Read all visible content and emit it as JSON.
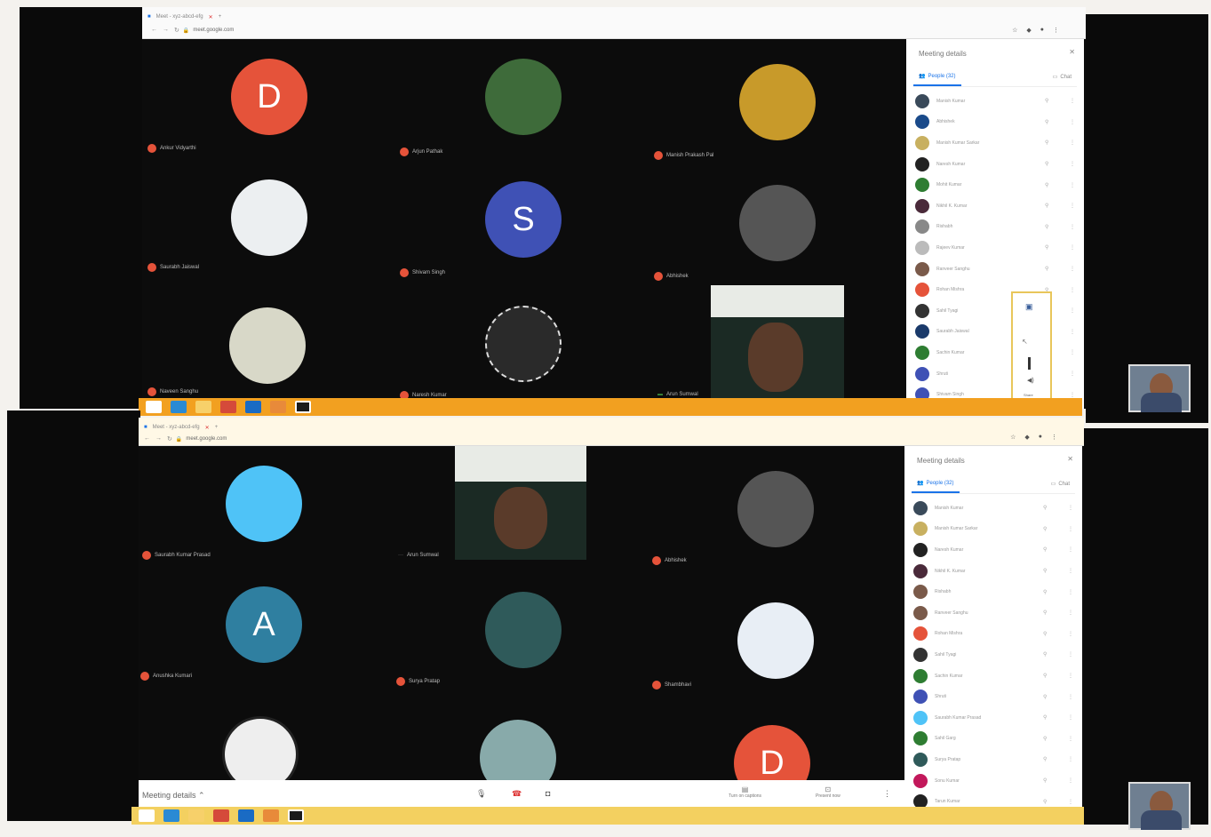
{
  "colors": {
    "accent": "#1a73e8",
    "mic_muted": "#e5533a",
    "taskbar_orange": "#f2a020"
  },
  "top": {
    "browser": {
      "tab_title": "Meet - xyz-abcd-efg",
      "url": "meet.google.com"
    },
    "tiles": [
      {
        "name": "Ankur Vidyarthi",
        "initial": "D",
        "color": "#e5533a",
        "type": "letter"
      },
      {
        "name": "Arjun Pathak",
        "color": "#3e6b3a",
        "type": "photo"
      },
      {
        "name": "Manish Prakash Pal",
        "color": "#c89a2a",
        "type": "photo"
      },
      {
        "name": "Saurabh Jaiswal",
        "color": "#eceff1",
        "type": "photo"
      },
      {
        "name": "Shivam Singh",
        "initial": "S",
        "color": "#3f51b5",
        "type": "letter"
      },
      {
        "name": "Abhishek",
        "color": "#555",
        "type": "photo"
      },
      {
        "name": "Naveen Sanghu",
        "color": "#d8d8c8",
        "type": "photo"
      },
      {
        "name": "Naresh Kumar",
        "color": "#2a2a2a",
        "type": "photo"
      },
      {
        "name": "Arun Sumwal",
        "type": "video"
      }
    ],
    "panel": {
      "title": "Meeting details",
      "tab_people": "People (32)",
      "tab_chat": "Chat",
      "participants": [
        {
          "name": "Manish Kumar",
          "color": "#3a4a5a"
        },
        {
          "name": "Abhishek",
          "color": "#1a4a8a"
        },
        {
          "name": "Manish Kumar Sarkar",
          "color": "#c8b060"
        },
        {
          "name": "Naresh Kumar",
          "color": "#222"
        },
        {
          "name": "Mohit Kumar",
          "color": "#2e7d32"
        },
        {
          "name": "Nikhil K. Kumar",
          "color": "#4a2a3a"
        },
        {
          "name": "Rishabh",
          "color": "#888"
        },
        {
          "name": "Rajeev Kumar",
          "color": "#bbb"
        },
        {
          "name": "Ranveer Sanghu",
          "color": "#7a5a4a"
        },
        {
          "name": "Rohan Mishra",
          "color": "#e5533a"
        },
        {
          "name": "Sahil Tyagi",
          "color": "#333"
        },
        {
          "name": "Saurabh Jaiswal",
          "color": "#1a3a6a"
        },
        {
          "name": "Sachin Kumar",
          "color": "#2e7d32"
        },
        {
          "name": "Shruti",
          "color": "#3f51b5"
        },
        {
          "name": "Shivam Singh",
          "color": "#3f51b5"
        }
      ]
    },
    "popup_label": "Share"
  },
  "bottom": {
    "browser": {
      "tab_title": "Meet - xyz-abcd-efg",
      "url": "meet.google.com"
    },
    "tiles": [
      {
        "name": "Saurabh Kumar Prasad",
        "color": "#4fc3f7",
        "type": "photo"
      },
      {
        "name": "Arun Sumwal",
        "type": "video"
      },
      {
        "name": "Abhishek",
        "color": "#555",
        "type": "photo"
      },
      {
        "name": "Anushka Kumari",
        "initial": "A",
        "color": "#2f7fa0",
        "type": "letter"
      },
      {
        "name": "Surya Pratap",
        "color": "#2f5a5a",
        "type": "photo"
      },
      {
        "name": "Shambhavi",
        "color": "#e8eef5",
        "type": "photo"
      },
      {
        "name": "",
        "color": "#eee",
        "type": "photo"
      },
      {
        "name": "",
        "color": "#8aa",
        "type": "photo"
      },
      {
        "name": "",
        "initial": "D",
        "color": "#e5533a",
        "type": "letter"
      }
    ],
    "panel": {
      "title": "Meeting details",
      "tab_people": "People (32)",
      "tab_chat": "Chat",
      "participants": [
        {
          "name": "Manish Kumar",
          "color": "#3a4a5a"
        },
        {
          "name": "Manish Kumar Sarkar",
          "color": "#c8b060"
        },
        {
          "name": "Naresh Kumar",
          "color": "#222"
        },
        {
          "name": "Nikhil K. Kumar",
          "color": "#4a2a3a"
        },
        {
          "name": "Rishabh",
          "color": "#7a5a4a"
        },
        {
          "name": "Ranveer Sanghu",
          "color": "#7a5a4a"
        },
        {
          "name": "Rohan Mishra",
          "color": "#e5533a"
        },
        {
          "name": "Sahil Tyagi",
          "color": "#333"
        },
        {
          "name": "Sachin Kumar",
          "color": "#2e7d32"
        },
        {
          "name": "Shruti",
          "color": "#3f51b5"
        },
        {
          "name": "Saurabh Kumar Prasad",
          "color": "#4fc3f7"
        },
        {
          "name": "Sahil Garg",
          "color": "#2e7d32"
        },
        {
          "name": "Surya Pratap",
          "color": "#2f5a5a"
        },
        {
          "name": "Sonu Kumar",
          "color": "#c2185b"
        },
        {
          "name": "Tarun Kumar",
          "color": "#222"
        }
      ]
    },
    "bottombar": {
      "meeting_details": "Meeting details",
      "turn_on_captions": "Turn on captions",
      "present_now": "Present now"
    }
  }
}
